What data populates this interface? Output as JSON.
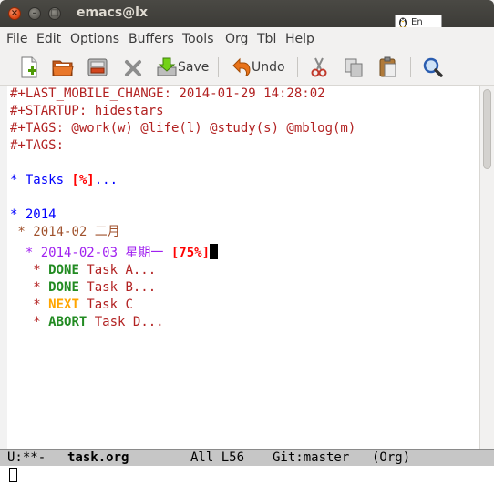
{
  "window": {
    "title": "emacs@lx",
    "ime_label": "En"
  },
  "menu": [
    "File",
    "Edit",
    "Options",
    "Buffers",
    "Tools",
    "Org",
    "Tbl",
    "Help"
  ],
  "toolbar": {
    "save_label": "Save",
    "undo_label": "Undo",
    "icons": [
      "new-file-icon",
      "open-folder-icon",
      "dired-icon",
      "close-buffer-icon",
      "save-icon",
      "undo-icon",
      "cut-icon",
      "copy-icon",
      "paste-icon",
      "search-icon"
    ]
  },
  "editor": {
    "lines": {
      "l1": "#+LAST_MOBILE_CHANGE: 2014-01-29 14:28:02",
      "l2": "#+STARTUP: hidestars",
      "l3": "#+TAGS: @work(w) @life(l) @study(s) @mblog(m)",
      "l4": "#+TAGS:",
      "tasks_star": "* ",
      "tasks_title": "Tasks ",
      "tasks_cookie": "[%]",
      "tasks_ellipsis": "...",
      "y2014": "* 2014",
      "month_star": " * ",
      "month": "2014-02 二月",
      "day_star": "  * ",
      "day": "2014-02-03 星期一 ",
      "day_cookie": "[75%]",
      "t1_star": "   * ",
      "t1_kw": "DONE",
      "t1_text": " Task A...",
      "t2_star": "   * ",
      "t2_kw": "DONE",
      "t2_text": " Task B...",
      "t3_star": "   * ",
      "t3_kw": "NEXT",
      "t3_text": " Task C",
      "t4_star": "   * ",
      "t4_kw": "ABORT",
      "t4_text": " Task D..."
    }
  },
  "modeline": {
    "status": "U:**-",
    "buffer": "task.org",
    "position": "All L56",
    "vc": "Git:master",
    "mode": "(Org)"
  },
  "colors": {
    "meta": "#b22222",
    "heading1": "#0000ff",
    "heading2": "#a0522d",
    "heading3": "#a020f0",
    "done": "#228b22",
    "next": "#ffa500",
    "cookie": "#ff0000"
  }
}
